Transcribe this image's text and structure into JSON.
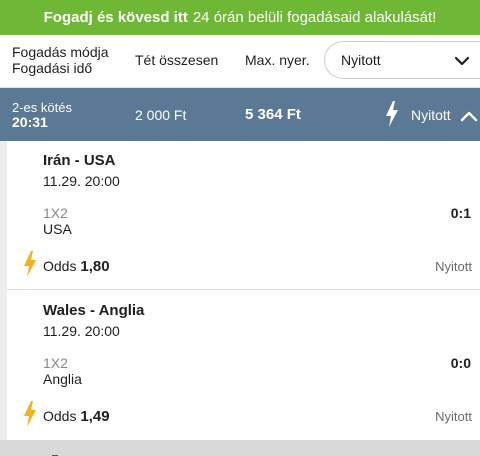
{
  "banner": {
    "bold_text": "Fogadj és kövesd itt",
    "text": "24 órán belüli fogadásaid alakulását!"
  },
  "filter": {
    "type_label": "Fogadás módja",
    "time_label": "Fogadási idő",
    "stake_label": "Tét összesen",
    "max_win_label": "Max. nyer.",
    "status_value": "Nyitott"
  },
  "summary": {
    "bet_type": "2-es kötés",
    "time": "20:31",
    "stake": "2 000 Ft",
    "max_win": "5 364 Ft",
    "status": "Nyitott"
  },
  "events": [
    {
      "teams": "Irán - USA",
      "datetime": "11.29. 20:00",
      "market": "1X2",
      "pick": "USA",
      "score": "0:1",
      "odds_label": "Odds",
      "odds": "1,80",
      "status": "Nyitott"
    },
    {
      "teams": "Wales - Anglia",
      "datetime": "11.29. 20:00",
      "market": "1X2",
      "pick": "Anglia",
      "score": "0:0",
      "odds_label": "Odds",
      "odds": "1,49",
      "status": "Nyitott"
    }
  ],
  "colors": {
    "banner_green": "#6fb836",
    "summary_blue": "#5b7895",
    "bolt_yellow": "#f5b21b"
  },
  "icons": {
    "dropdown": "chevron-down-icon",
    "collapse": "chevron-up-icon",
    "live": "lightning-bolt-icon"
  }
}
